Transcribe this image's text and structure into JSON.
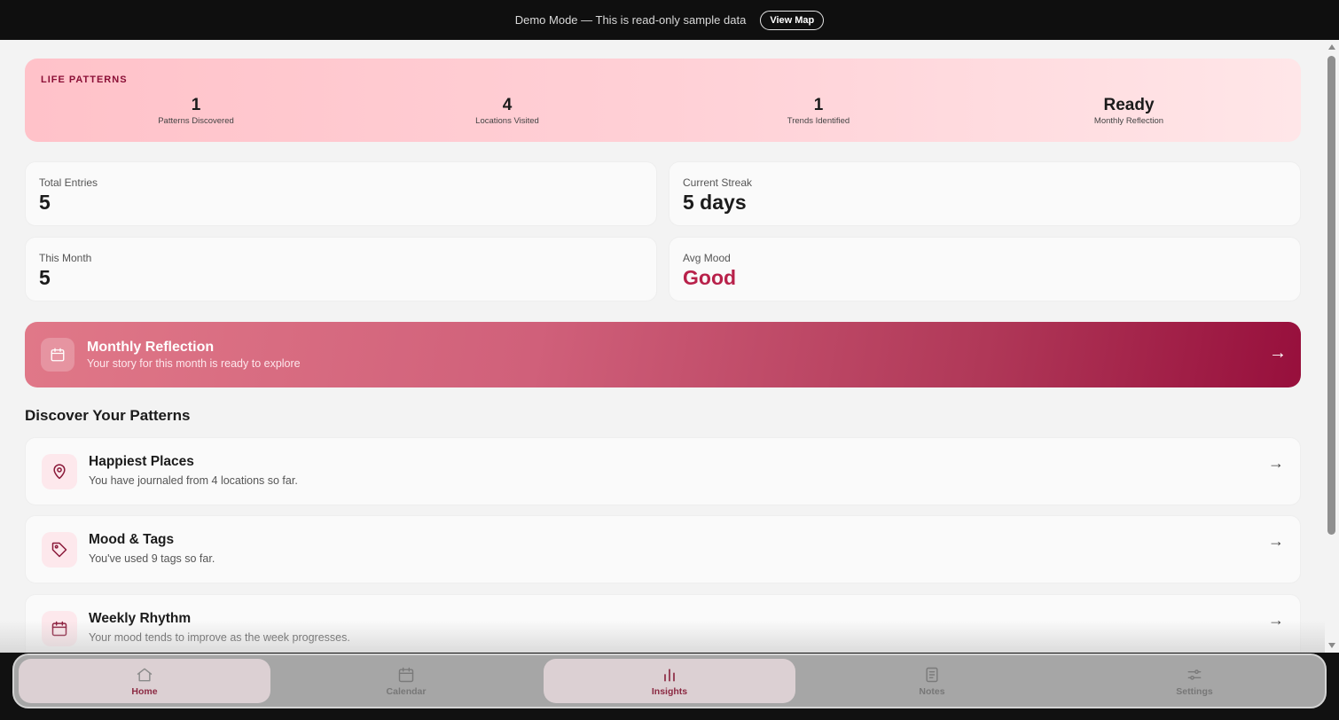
{
  "topbar": {
    "demo_text": "Demo Mode — This is read-only sample data",
    "view_map_label": "View Map"
  },
  "life_patterns": {
    "title": "LIFE PATTERNS",
    "stats": [
      {
        "value": "1",
        "label": "Patterns Discovered"
      },
      {
        "value": "4",
        "label": "Locations Visited"
      },
      {
        "value": "1",
        "label": "Trends Identified"
      },
      {
        "value": "Ready",
        "label": "Monthly Reflection"
      }
    ]
  },
  "stats": {
    "total_entries": {
      "label": "Total Entries",
      "value": "5"
    },
    "current_streak": {
      "label": "Current Streak",
      "value": "5 days"
    },
    "this_month": {
      "label": "This Month",
      "value": "5"
    },
    "avg_mood": {
      "label": "Avg Mood",
      "value": "Good"
    }
  },
  "reflection": {
    "icon": "calendar-icon",
    "title": "Monthly Reflection",
    "subtitle": "Your story for this month is ready to explore",
    "arrow": "→"
  },
  "discover": {
    "title": "Discover Your Patterns",
    "items": [
      {
        "icon": "map-pin-icon",
        "title": "Happiest Places",
        "subtitle": "You have journaled from 4 locations so far.",
        "arrow": "→"
      },
      {
        "icon": "tag-icon",
        "title": "Mood & Tags",
        "subtitle": "You've used 9 tags so far.",
        "arrow": "→"
      },
      {
        "icon": "calendar-icon",
        "title": "Weekly Rhythm",
        "subtitle": "Your mood tends to improve as the week progresses.",
        "arrow": "→"
      }
    ]
  },
  "nav": {
    "items": [
      {
        "label": "Home",
        "icon": "home-icon",
        "active": true
      },
      {
        "label": "Calendar",
        "icon": "calendar-icon",
        "active": false
      },
      {
        "label": "Insights",
        "icon": "bar-chart-icon",
        "active": true
      },
      {
        "label": "Notes",
        "icon": "notes-icon",
        "active": false
      },
      {
        "label": "Settings",
        "icon": "sliders-icon",
        "active": false
      }
    ]
  },
  "colors": {
    "accent": "#b8214a",
    "brand_dark": "#8b0f36",
    "topbar": "#0f0f0f"
  }
}
